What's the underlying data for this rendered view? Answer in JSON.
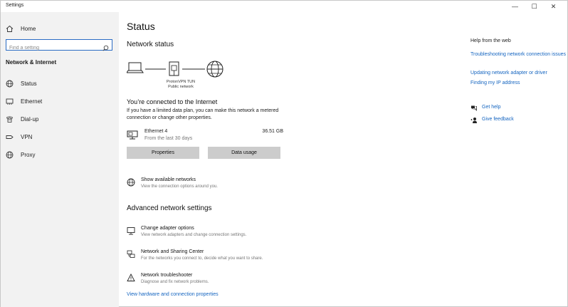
{
  "window": {
    "title": "Settings",
    "minimize_glyph": "—",
    "maximize_glyph": "☐",
    "close_glyph": "✕"
  },
  "sidebar": {
    "home_label": "Home",
    "search_placeholder": "Find a setting",
    "section_label": "Network & Internet",
    "items": [
      {
        "label": "Status",
        "icon": "globe-icon",
        "selected": true
      },
      {
        "label": "Ethernet",
        "icon": "ethernet-icon"
      },
      {
        "label": "Dial-up",
        "icon": "phone-icon"
      },
      {
        "label": "VPN",
        "icon": "vpn-icon"
      },
      {
        "label": "Proxy",
        "icon": "globe-icon"
      }
    ]
  },
  "main": {
    "title": "Status",
    "network_status_heading": "Network status",
    "diagram": {
      "connection_name": "ProtonVPN TUN",
      "network_type": "Public network"
    },
    "connected_heading": "You’re connected to the Internet",
    "connected_desc": "If you have a limited data plan, you can make this network a metered connection or change other properties.",
    "ethernet": {
      "name": "Ethernet 4",
      "period": "From the last 30 days",
      "usage": "36.51 GB"
    },
    "buttons": {
      "properties": "Properties",
      "data_usage": "Data usage"
    },
    "show_networks": {
      "title": "Show available networks",
      "desc": "View the connection options around you."
    },
    "advanced_heading": "Advanced network settings",
    "adapter": {
      "title": "Change adapter options",
      "desc": "View network adapters and change connection settings."
    },
    "sharing": {
      "title": "Network and Sharing Center",
      "desc": "For the networks you connect to, decide what you want to share."
    },
    "troubleshooter": {
      "title": "Network troubleshooter",
      "desc": "Diagnose and fix network problems."
    },
    "hw_link": "View hardware and connection properties"
  },
  "help": {
    "heading": "Help from the web",
    "links": [
      "Troubleshooting network connection issues",
      "Updating network adapter or driver",
      "Finding my IP address"
    ],
    "get_help": "Get help",
    "give_feedback": "Give feedback"
  },
  "colors": {
    "accent": "#1565c0",
    "sidebar_bg": "#f2f2f2",
    "button_bg": "#cccccc"
  }
}
